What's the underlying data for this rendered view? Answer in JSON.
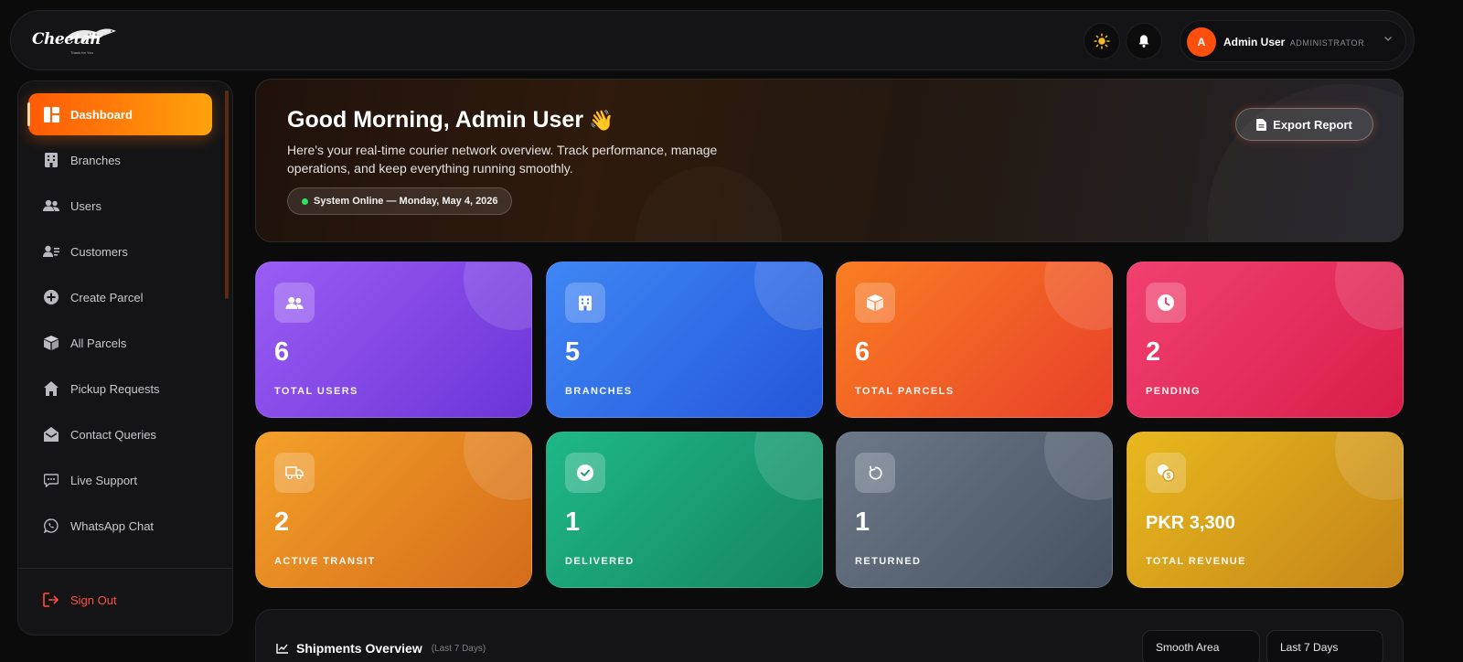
{
  "brand": {
    "name": "Cheetah",
    "tagline": "Thank for You"
  },
  "header": {
    "user_initial": "A",
    "user_name": "Admin User",
    "user_role": "ADMINISTRATOR",
    "theme_icon": "sun-icon",
    "notification_icon": "bell-icon"
  },
  "sidebar": {
    "items": [
      {
        "label": "Dashboard",
        "icon": "dashboard-icon",
        "active": true
      },
      {
        "label": "Branches",
        "icon": "building-icon"
      },
      {
        "label": "Users",
        "icon": "users-icon"
      },
      {
        "label": "Customers",
        "icon": "customers-icon"
      },
      {
        "label": "Create Parcel",
        "icon": "plus-circle-icon"
      },
      {
        "label": "All Parcels",
        "icon": "box-icon"
      },
      {
        "label": "Pickup Requests",
        "icon": "home-icon"
      },
      {
        "label": "Contact Queries",
        "icon": "mail-icon"
      },
      {
        "label": "Live Support",
        "icon": "chat-icon"
      },
      {
        "label": "WhatsApp Chat",
        "icon": "whatsapp-icon"
      }
    ],
    "sign_out": "Sign Out"
  },
  "hero": {
    "greeting": "Good Morning, Admin User",
    "wave": "👋",
    "subtitle": "Here's your real-time courier network overview. Track performance, manage operations, and keep everything running smoothly.",
    "status": "System Online — Monday, May 4, 2026",
    "export_label": "Export Report"
  },
  "stats": [
    {
      "value": "6",
      "label": "TOTAL USERS",
      "icon": "users-icon",
      "color": "#8b4ff0"
    },
    {
      "value": "5",
      "label": "BRANCHES",
      "icon": "building-icon",
      "color": "#3270ea"
    },
    {
      "value": "6",
      "label": "TOTAL PARCELS",
      "icon": "box-icon",
      "color": "#f26023"
    },
    {
      "value": "2",
      "label": "PENDING",
      "icon": "clock-icon",
      "color": "#e62e5c"
    },
    {
      "value": "2",
      "label": "ACTIVE TRANSIT",
      "icon": "truck-icon",
      "color": "#e88a24"
    },
    {
      "value": "1",
      "label": "DELIVERED",
      "icon": "check-circle-icon",
      "color": "#1a9e74"
    },
    {
      "value": "1",
      "label": "RETURNED",
      "icon": "rotate-icon",
      "color": "#596475"
    },
    {
      "value": "PKR 3,300",
      "label": "TOTAL REVENUE",
      "icon": "coins-icon",
      "color": "#d99e1b"
    }
  ],
  "shipments": {
    "title": "Shipments Overview",
    "subtitle": "(Last 7 Days)",
    "chart_type_selected": "Smooth Area",
    "range_selected": "Last 7 Days"
  }
}
